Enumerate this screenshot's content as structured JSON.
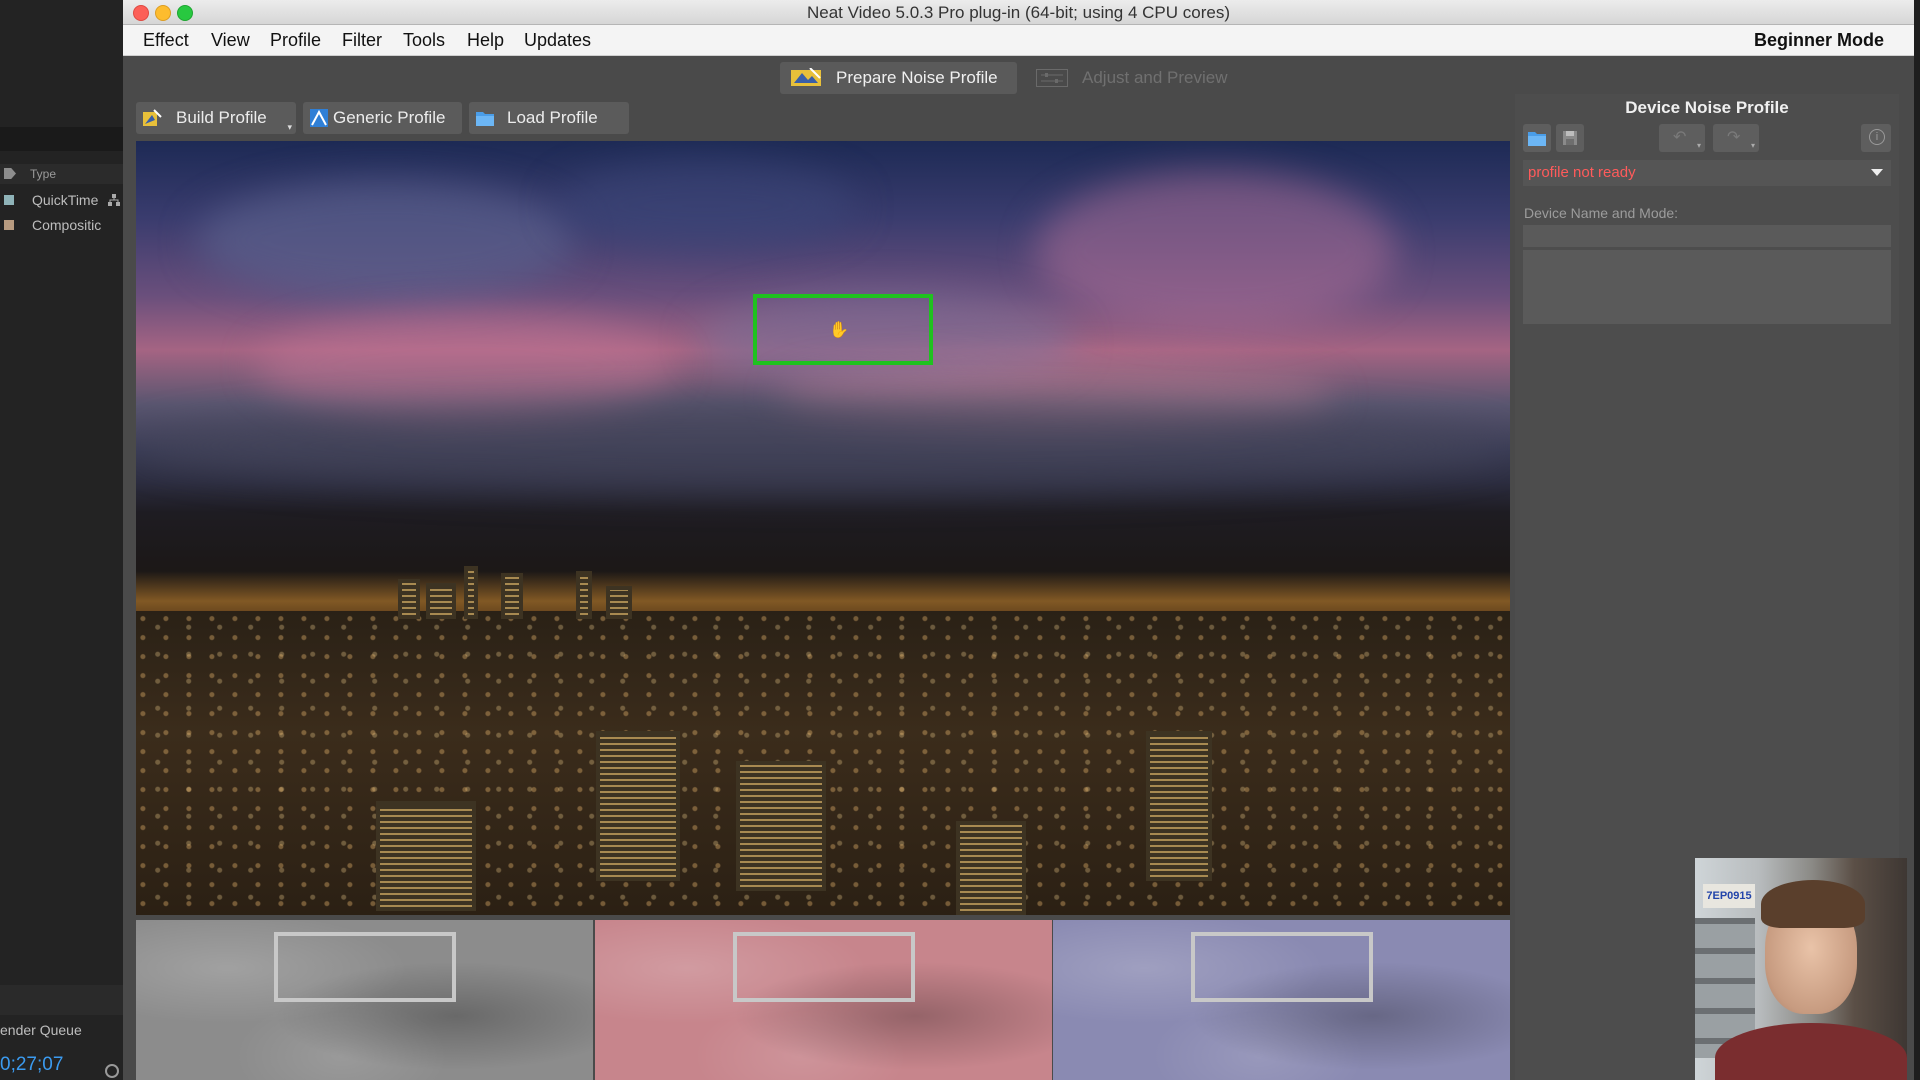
{
  "window": {
    "title": "Neat Video 5.0.3 Pro plug-in (64-bit; using 4 CPU cores)"
  },
  "menubar": {
    "items": [
      "Effect",
      "View",
      "Profile",
      "Filter",
      "Tools",
      "Help",
      "Updates"
    ],
    "mode": "Beginner Mode"
  },
  "tabs": {
    "prepare": "Prepare Noise Profile",
    "adjust": "Adjust and Preview"
  },
  "toolbar": {
    "build_profile": "Build Profile",
    "generic_profile": "Generic Profile",
    "load_profile": "Load Profile"
  },
  "panel": {
    "title": "Device Noise Profile",
    "profile_status": "profile not ready",
    "device_label": "Device Name and Mode:"
  },
  "host": {
    "column_type": "Type",
    "rows": [
      "QuickTime",
      "Compositic"
    ],
    "render_queue": "ender Queue",
    "timecode": "0;27;07"
  },
  "webcam": {
    "sign_text": "7EP0915"
  },
  "colors": {
    "selection": "#1fc21f",
    "status_error": "#ff5b5b",
    "timecode": "#3b9bf0",
    "preview_luma": "#8c8c8c",
    "preview_red": "#c7858c",
    "preview_blue": "#8a8ab2"
  },
  "icons": {
    "build": "wand-icon",
    "generic": "generic-profile-icon",
    "load": "folder-icon",
    "panel_open": "folder-icon",
    "panel_save": "save-icon",
    "undo": "undo-icon",
    "redo": "redo-icon",
    "info": "info-icon"
  }
}
